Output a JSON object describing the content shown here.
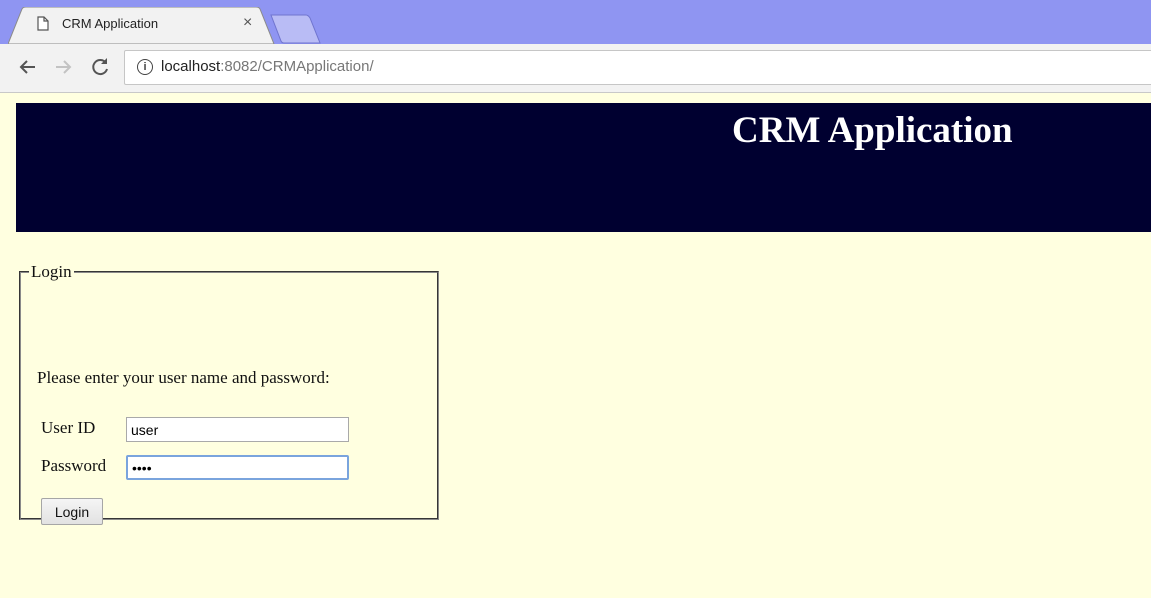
{
  "browser": {
    "tab_title": "CRM Application",
    "tab_close": "×",
    "url_host": "localhost",
    "url_rest": ":8082/CRMApplication/",
    "icons": {
      "back": "back-arrow-icon",
      "forward": "forward-arrow-icon",
      "reload": "reload-icon",
      "info": "info-icon",
      "page": "page-icon"
    }
  },
  "header": {
    "title": "CRM Application"
  },
  "login": {
    "legend": "Login",
    "prompt": "Please enter your user name and password:",
    "user_label": "User ID",
    "user_value": "user",
    "password_label": "Password",
    "password_value": "••••",
    "button_label": "Login"
  },
  "colors": {
    "tabstrip": "#8f95f2",
    "page_background": "#ffffe0",
    "header_background": "#000030",
    "header_text": "#ffffff"
  }
}
